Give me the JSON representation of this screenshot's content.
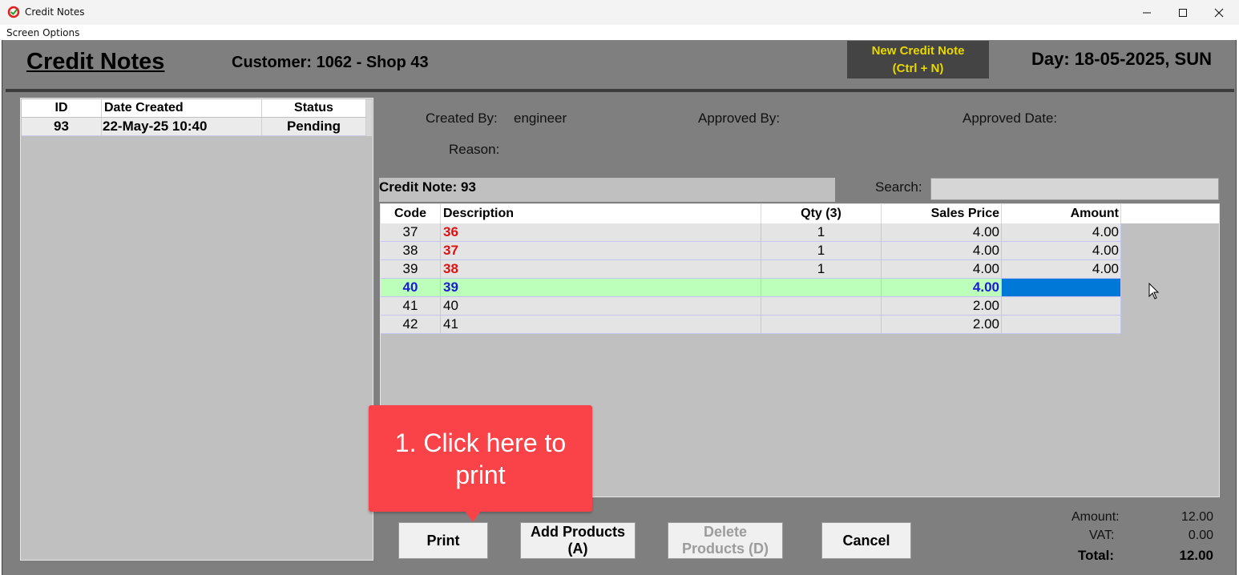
{
  "window": {
    "title": "Credit Notes",
    "menu": [
      "Screen Options"
    ]
  },
  "header": {
    "page_title": "Credit Notes",
    "customer": "Customer: 1062 - Shop 43",
    "new_button_line1": "New Credit Note",
    "new_button_line2": "(Ctrl + N)",
    "day": "Day: 18-05-2025, SUN"
  },
  "list": {
    "columns": [
      "ID",
      "Date Created",
      "Status"
    ],
    "rows": [
      {
        "id": "93",
        "date": "22-May-25 10:40",
        "status": "Pending"
      }
    ]
  },
  "info": {
    "created_by_label": "Created By:",
    "created_by_value": "engineer",
    "approved_by_label": "Approved By:",
    "approved_date_label": "Approved Date:",
    "reason_label": "Reason:",
    "credit_note_label": "Credit Note: 93",
    "search_label": "Search:",
    "search_value": ""
  },
  "grid": {
    "columns": [
      "Code",
      "Description",
      "Qty (3)",
      "Sales Price",
      "Amount"
    ],
    "rows": [
      {
        "code": "37",
        "desc": "36",
        "qty": "1",
        "price": "4.00",
        "amount": "4.00"
      },
      {
        "code": "38",
        "desc": "37",
        "qty": "1",
        "price": "4.00",
        "amount": "4.00"
      },
      {
        "code": "39",
        "desc": "38",
        "qty": "1",
        "price": "4.00",
        "amount": "4.00"
      },
      {
        "code": "40",
        "desc": "39",
        "qty": "",
        "price": "4.00",
        "amount": ""
      },
      {
        "code": "41",
        "desc": "40",
        "qty": "",
        "price": "2.00",
        "amount": ""
      },
      {
        "code": "42",
        "desc": "41",
        "qty": "",
        "price": "2.00",
        "amount": ""
      }
    ]
  },
  "buttons": {
    "print": "Print",
    "add_line1": "Add Products",
    "add_line2": "(A)",
    "delete_line1": "Delete",
    "delete_line2": "Products (D)",
    "cancel": "Cancel"
  },
  "totals": {
    "amount_label": "Amount:",
    "amount_value": "12.00",
    "vat_label": "VAT:",
    "vat_value": "0.00",
    "total_label": "Total:",
    "total_value": "12.00"
  },
  "callout": {
    "line1": "1. Click here to",
    "line2": "print"
  },
  "colors": {
    "background": "#7f7f7f",
    "highlight_row": "#bbffbb",
    "selected_cell": "#0078d7",
    "callout": "#fa4249",
    "new_button_text": "#e8d800"
  }
}
